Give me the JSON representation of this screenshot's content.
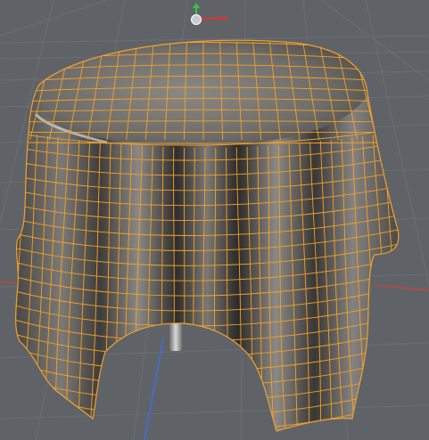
{
  "viewport": {
    "view": "perspective",
    "background_color": "#5f6368",
    "grid_color": "#6f7378",
    "wireframe_color": "#f3a12b",
    "axis_colors": {
      "x": "#e0332f",
      "y": "#37c53f",
      "z": "#3a6fe0"
    },
    "object": {
      "type": "cloth-tablecloth-mesh",
      "selected": true
    },
    "gizmo_icon": "move-gizmo-icon"
  }
}
